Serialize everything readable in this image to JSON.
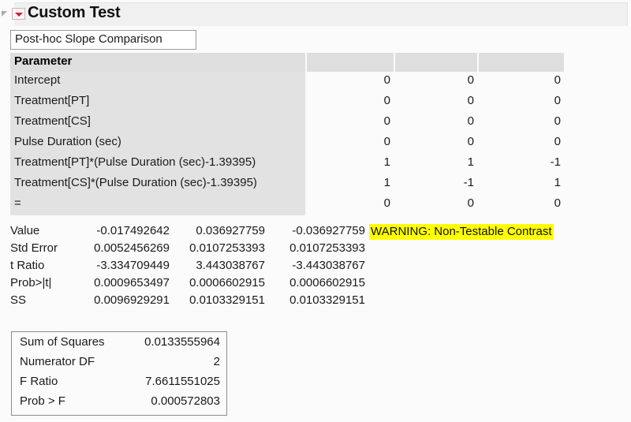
{
  "panel": {
    "title": "Custom Test",
    "disclosure_icon": "disclosure-triangle-icon",
    "menu_icon": "red-triangle-menu-icon"
  },
  "test_name_field": {
    "value": "Post-hoc Slope Comparison",
    "placeholder": "Custom Test"
  },
  "parameter_table": {
    "headers": [
      "Parameter",
      "",
      "",
      ""
    ],
    "rows": [
      {
        "parameter": "Intercept",
        "c1": "0",
        "c2": "0",
        "c3": "0"
      },
      {
        "parameter": "Treatment[PT]",
        "c1": "0",
        "c2": "0",
        "c3": "0"
      },
      {
        "parameter": "Treatment[CS]",
        "c1": "0",
        "c2": "0",
        "c3": "0"
      },
      {
        "parameter": "Pulse Duration (sec)",
        "c1": "0",
        "c2": "0",
        "c3": "0"
      },
      {
        "parameter": "Treatment[PT]*(Pulse Duration (sec)-1.39395)",
        "c1": "1",
        "c2": "1",
        "c3": "-1"
      },
      {
        "parameter": "Treatment[CS]*(Pulse Duration (sec)-1.39395)",
        "c1": "1",
        "c2": "-1",
        "c3": "1"
      },
      {
        "parameter": "=",
        "c1": "0",
        "c2": "0",
        "c3": "0"
      }
    ]
  },
  "statistics": {
    "rows": [
      {
        "label": "Value",
        "c1": "-0.017492642",
        "c2": "0.036927759",
        "c3": "-0.036927759"
      },
      {
        "label": "Std Error",
        "c1": "0.0052456269",
        "c2": "0.0107253393",
        "c3": "0.0107253393"
      },
      {
        "label": "t Ratio",
        "c1": "-3.334709449",
        "c2": "3.443038767",
        "c3": "-3.443038767"
      },
      {
        "label": "Prob>|t|",
        "c1": "0.0009653497",
        "c2": "0.0006602915",
        "c3": "0.0006602915"
      },
      {
        "label": "SS",
        "c1": "0.0096929291",
        "c2": "0.0103329151",
        "c3": "0.0103329151"
      }
    ],
    "warning": "WARNING: Non-Testable Contrast",
    "warning_highlight_color": "#ffff00"
  },
  "summary": {
    "rows": [
      {
        "label": "Sum of Squares",
        "value": "0.0133555964"
      },
      {
        "label": "Numerator DF",
        "value": "2"
      },
      {
        "label": "F Ratio",
        "value": "7.6611551025"
      },
      {
        "label": "Prob > F",
        "value": "0.000572803"
      }
    ]
  }
}
